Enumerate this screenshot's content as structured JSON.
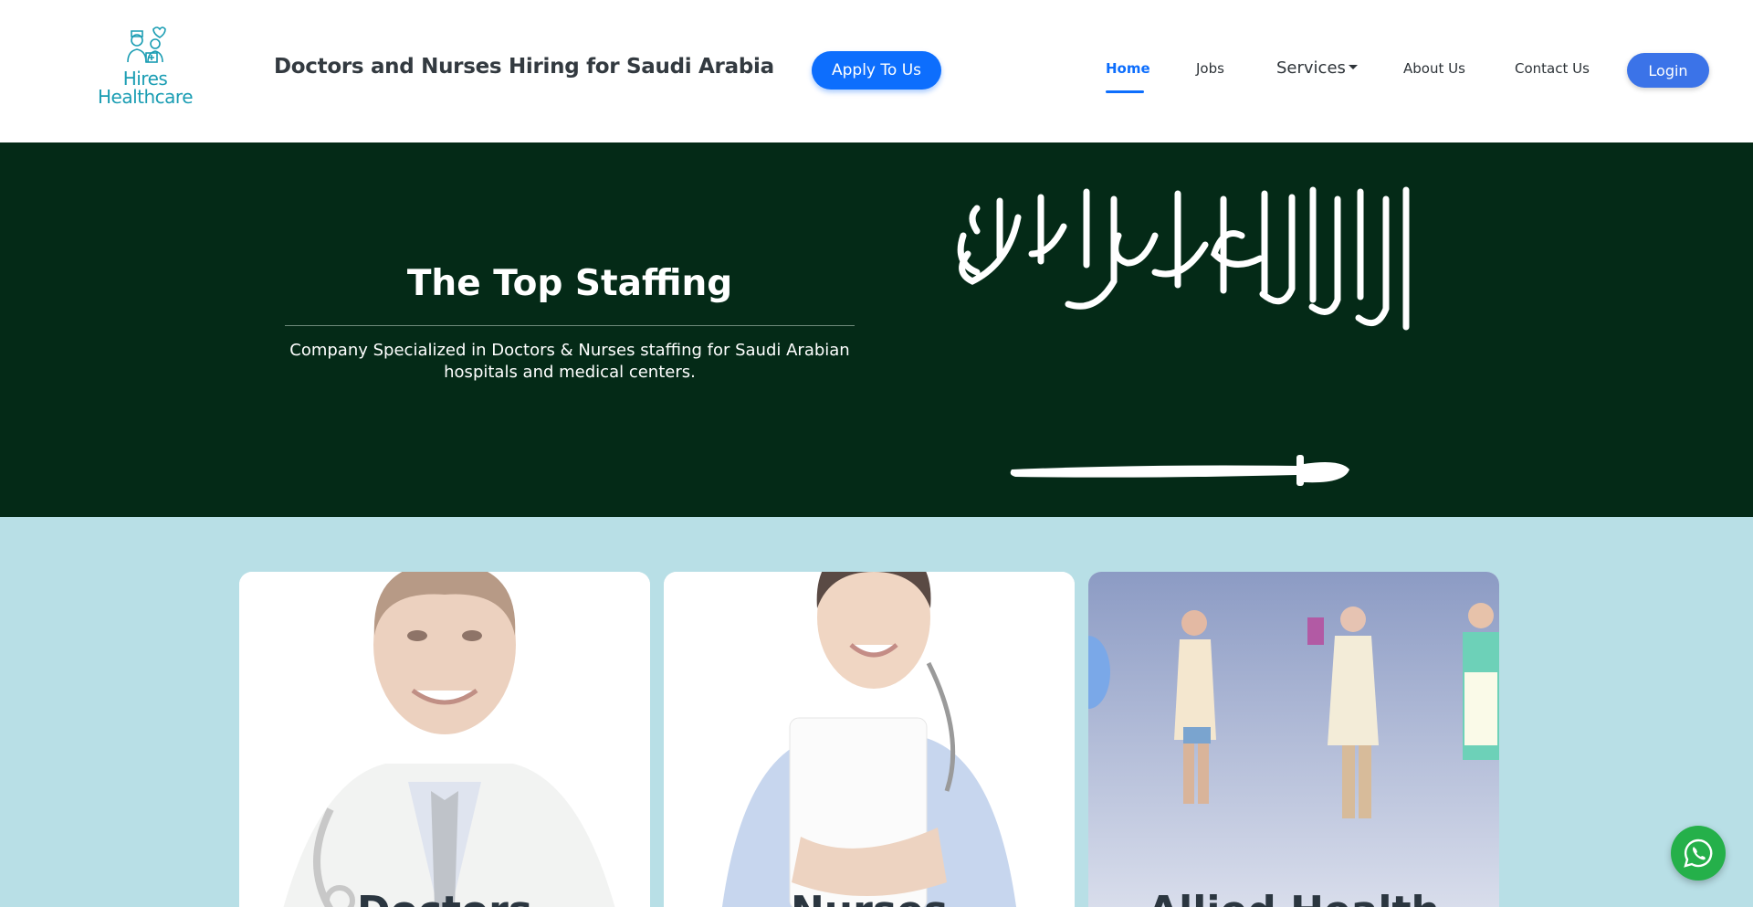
{
  "header": {
    "logo_line1": "Hires",
    "logo_line2": "Healthcare",
    "site_title": "Doctors and Nurses Hiring for Saudi Arabia",
    "apply_label": "Apply To Us",
    "nav": {
      "home": "Home",
      "jobs": "Jobs",
      "services": "Services",
      "about": "About Us",
      "contact": "Contact Us"
    },
    "login_label": "Login"
  },
  "hero": {
    "title": "The Top Staffing",
    "subtitle": "Company Specialized in Doctors & Nurses staffing for Saudi Arabian hospitals and medical centers."
  },
  "cards": [
    {
      "title": "Doctors"
    },
    {
      "title": "Nurses"
    },
    {
      "title": "Allied Health"
    }
  ],
  "icons": {
    "logo": "nurse-doctor-logo-icon",
    "whatsapp": "whatsapp-icon",
    "services_caret": "caret-down-icon"
  },
  "colors": {
    "primary": "#0d6efd",
    "logo_teal": "#1a9db3",
    "hero_bg": "#042a17",
    "page_bg": "#b8dfe6",
    "whatsapp": "#25b04a"
  }
}
